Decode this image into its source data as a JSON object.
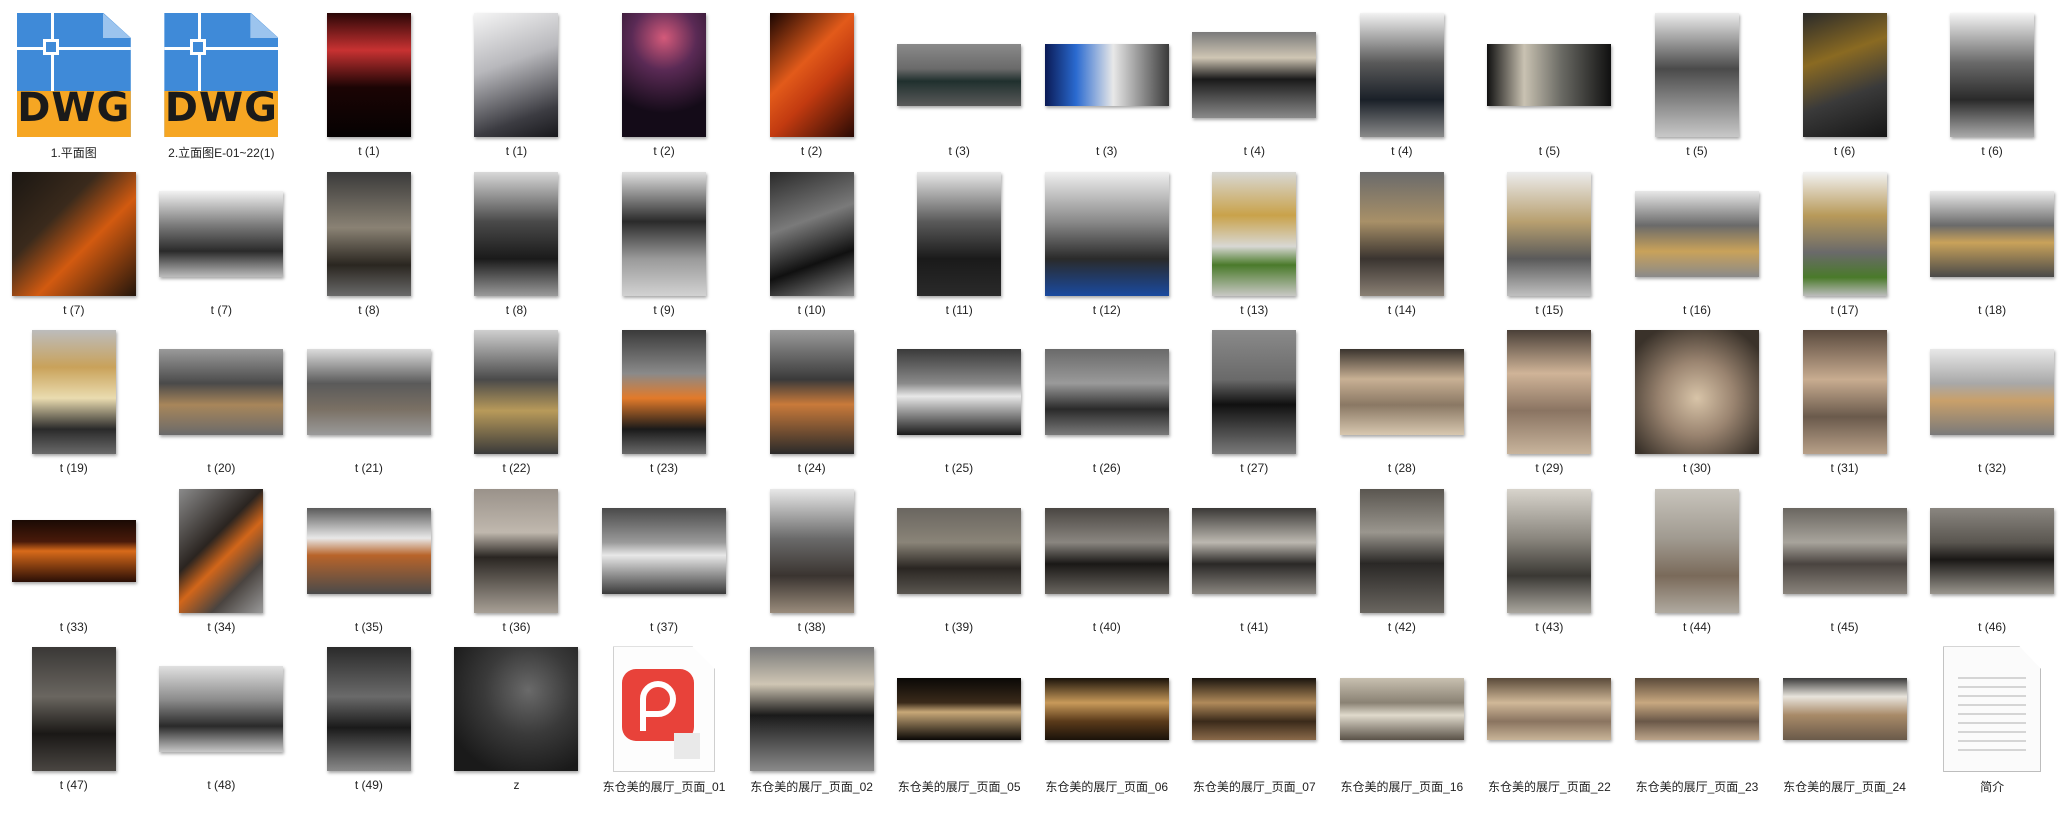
{
  "view": "large-icons",
  "files": [
    {
      "label": "1.平面图",
      "type": "dwg",
      "icon": "dwg-file-icon"
    },
    {
      "label": "2.立面图E-01~22(1)",
      "type": "dwg",
      "icon": "dwg-file-icon"
    },
    {
      "label": "t (1)",
      "type": "image",
      "shape": "portrait",
      "bg": "linear-gradient(180deg,#2a0606 0%,#c83232 30%,#1b0404 60%,#050202 100%)"
    },
    {
      "label": "t (1)",
      "type": "image",
      "shape": "portrait",
      "bg": "linear-gradient(160deg,#f5f5f5 0%,#b8b8bc 40%,#3c3c42 80%,#18181c 100%)"
    },
    {
      "label": "t (2)",
      "type": "image",
      "shape": "portrait",
      "bg": "radial-gradient(circle at 50% 20%,#d45a7a 0%,#5a2a55 30%,#140b18 70%)"
    },
    {
      "label": "t (2)",
      "type": "image",
      "shape": "portrait",
      "bg": "linear-gradient(135deg,#1a0602 0%,#e25a1a 40%,#c23a10 60%,#2a0a04 100%)"
    },
    {
      "label": "t (3)",
      "type": "image",
      "shape": "wide",
      "bg": "linear-gradient(180deg,#8a8a8a 0%,#6a6a6a 40%,#20302e 60%,#5a5a5a 100%)"
    },
    {
      "label": "t (3)",
      "type": "image",
      "shape": "wide",
      "bg": "linear-gradient(90deg,#0a1a55 0%,#2a6ad0 25%,#e8e8e8 55%,#3a3a3a 100%)"
    },
    {
      "label": "t (4)",
      "type": "image",
      "shape": "landscape",
      "bg": "linear-gradient(180deg,#7a7a7a 0%,#cfc6b4 30%,#1a1a1a 55%,#8a8a8a 100%)"
    },
    {
      "label": "t (4)",
      "type": "image",
      "shape": "portrait",
      "bg": "linear-gradient(180deg,#f2f2f2 0%,#5a5a5a 40%,#1a2028 70%,#8a8a8a 100%)"
    },
    {
      "label": "t (5)",
      "type": "image",
      "shape": "wide",
      "bg": "linear-gradient(90deg,#101010 0%,#c9c2b2 30%,#6a6a64 60%,#101010 100%)"
    },
    {
      "label": "t (5)",
      "type": "image",
      "shape": "portrait",
      "bg": "linear-gradient(180deg,#ededed 0%,#4a4a4a 45%,#c8c8c8 100%)"
    },
    {
      "label": "t (6)",
      "type": "image",
      "shape": "portrait",
      "bg": "linear-gradient(160deg,#2a2a2a 0%,#8a6a22 35%,#3a3a3a 65%,#161616 100%)"
    },
    {
      "label": "t (6)",
      "type": "image",
      "shape": "portrait",
      "bg": "linear-gradient(180deg,#f5f5f5 0%,#6a6a6a 40%,#2a2a2a 70%,#aaaaaa 100%)"
    },
    {
      "label": "t (7)",
      "type": "image",
      "shape": "square",
      "bg": "linear-gradient(135deg,#1a1612 0%,#3a2a1c 35%,#d25a10 60%,#24160c 100%)"
    },
    {
      "label": "t (7)",
      "type": "image",
      "shape": "landscape",
      "bg": "linear-gradient(180deg,#f2f2f2 0%,#7a7a7a 40%,#2a2a2a 70%,#bcbcbc 100%)"
    },
    {
      "label": "t (8)",
      "type": "image",
      "shape": "portrait",
      "bg": "linear-gradient(180deg,#3a3a3a 0%,#8a8274 45%,#2a2620 75%,#6a6a6a 100%)"
    },
    {
      "label": "t (8)",
      "type": "image",
      "shape": "portrait",
      "bg": "linear-gradient(180deg,#d8d8d8 0%,#4a4a4a 40%,#1a1a1a 70%,#9a9a9a 100%)"
    },
    {
      "label": "t (9)",
      "type": "image",
      "shape": "portrait",
      "bg": "linear-gradient(180deg,#e0e0e0 0%,#2a2a2a 40%,#9a9a9a 70%,#d2d2d2 100%)"
    },
    {
      "label": "t (10)",
      "type": "image",
      "shape": "portrait",
      "bg": "linear-gradient(160deg,#2a2a2a 0%,#7a7a7a 40%,#101010 70%,#8a8a8a 100%)"
    },
    {
      "label": "t (11)",
      "type": "image",
      "shape": "portrait",
      "bg": "linear-gradient(180deg,#e8e8e8 0%,#5a5a5a 40%,#1a1a1a 70%,#2a2a2a 100%)"
    },
    {
      "label": "t (12)",
      "type": "image",
      "shape": "square",
      "bg": "linear-gradient(180deg,#f0f0f0 0%,#8a8a8a 40%,#2a2a2a 70%,#1a4aa0 100%)"
    },
    {
      "label": "t (13)",
      "type": "image",
      "shape": "portrait",
      "bg": "linear-gradient(180deg,#d8d8d4 0%,#c9a24a 35%,#d8d8d4 60%,#4a7a2a 75%,#c8c8c4 100%)"
    },
    {
      "label": "t (14)",
      "type": "image",
      "shape": "portrait",
      "bg": "linear-gradient(180deg,#6a6a6a 0%,#a89068 40%,#3a3430 70%,#8a8074 100%)"
    },
    {
      "label": "t (15)",
      "type": "image",
      "shape": "portrait",
      "bg": "linear-gradient(180deg,#ececec 0%,#b8a070 40%,#5a5a5a 70%,#c0c0c0 100%)"
    },
    {
      "label": "t (16)",
      "type": "image",
      "shape": "landscape",
      "bg": "linear-gradient(180deg,#e8e8e8 0%,#6a6a6a 40%,#c9a25a 70%,#8a8a8a 100%)"
    },
    {
      "label": "t (17)",
      "type": "image",
      "shape": "portrait",
      "bg": "linear-gradient(180deg,#f2f2f2 0%,#b89a5a 35%,#6a6a6a 65%,#4a7a2a 85%,#bcbcbc 100%)"
    },
    {
      "label": "t (18)",
      "type": "image",
      "shape": "landscape",
      "bg": "linear-gradient(180deg,#ececec 0%,#6a6a6a 40%,#c9a25a 60%,#4a4a4a 100%)"
    },
    {
      "label": "t (19)",
      "type": "image",
      "shape": "portrait",
      "bg": "linear-gradient(180deg,#bcbcbc 0%,#c9a25a 30%,#eadcb0 55%,#2a2a2a 80%,#6a6a6a 100%)"
    },
    {
      "label": "t (20)",
      "type": "image",
      "shape": "landscape",
      "bg": "linear-gradient(180deg,#9a9a9a 0%,#4a4a4a 40%,#a8865a 65%,#6a6a6a 100%)"
    },
    {
      "label": "t (21)",
      "type": "image",
      "shape": "landscape",
      "bg": "linear-gradient(180deg,#dcdcdc 0%,#5a5a5a 40%,#7a7064 70%,#9a9a9a 100%)"
    },
    {
      "label": "t (22)",
      "type": "image",
      "shape": "portrait",
      "bg": "linear-gradient(180deg,#cfcfcf 0%,#4a4a4a 40%,#b89a5a 65%,#3a3a3a 100%)"
    },
    {
      "label": "t (23)",
      "type": "image",
      "shape": "portrait",
      "bg": "linear-gradient(180deg,#3a3a3a 0%,#8a8a8a 35%,#e27a2a 55%,#1a1a1a 80%,#6a6a6a 100%)"
    },
    {
      "label": "t (24)",
      "type": "image",
      "shape": "portrait",
      "bg": "linear-gradient(180deg,#9a9a9a 0%,#3a3a3a 40%,#c97a3a 60%,#2a2a2a 100%)"
    },
    {
      "label": "t (25)",
      "type": "image",
      "shape": "landscape",
      "bg": "linear-gradient(180deg,#3a3a3a 0%,#8a8a8a 40%,#e8e8e8 55%,#1a1a1a 100%)"
    },
    {
      "label": "t (26)",
      "type": "image",
      "shape": "landscape",
      "bg": "linear-gradient(180deg,#6a6a6a 0%,#9a9a9a 40%,#2a2a2a 70%,#7a7a7a 100%)"
    },
    {
      "label": "t (27)",
      "type": "image",
      "shape": "portrait",
      "bg": "linear-gradient(180deg,#8a8a8a 0%,#6a6a6a 40%,#101010 60%,#7a7a7a 100%)"
    },
    {
      "label": "t (28)",
      "type": "image",
      "shape": "landscape",
      "bg": "linear-gradient(180deg,#3a342e 0%,#c8b094 35%,#8a7864 65%,#d8c8b0 100%)"
    },
    {
      "label": "t (29)",
      "type": "image",
      "shape": "portrait",
      "bg": "linear-gradient(180deg,#4a4038 0%,#d0b498 35%,#8a7462 65%,#c8b49c 100%)"
    },
    {
      "label": "t (30)",
      "type": "image",
      "shape": "square",
      "bg": "radial-gradient(circle at 50% 55%,#d8c4a8 0%,#9a8470 40%,#3a322a 85%)"
    },
    {
      "label": "t (31)",
      "type": "image",
      "shape": "portrait",
      "bg": "linear-gradient(180deg,#5a4a3e 0%,#c8ac90 40%,#6a5a4c 70%,#b8a088 100%)"
    },
    {
      "label": "t (32)",
      "type": "image",
      "shape": "landscape",
      "bg": "linear-gradient(180deg,#e8e8e8 0%,#a8a8a8 40%,#c9a06a 60%,#7a7a7a 100%)"
    },
    {
      "label": "t (33)",
      "type": "image",
      "shape": "wide",
      "bg": "linear-gradient(180deg,#1a0a04 0%,#4a1a0a 35%,#d86a1a 50%,#2a0e06 100%)"
    },
    {
      "label": "t (34)",
      "type": "image",
      "shape": "portrait",
      "bg": "linear-gradient(135deg,#8a8a8a 0%,#2a2420 40%,#d2661a 55%,#4a4440 75%,#9a9a9a 100%)"
    },
    {
      "label": "t (35)",
      "type": "image",
      "shape": "landscape",
      "bg": "linear-gradient(180deg,#5a5a5a 0%,#e8e8e8 35%,#b8642a 55%,#4a4a4a 100%)"
    },
    {
      "label": "t (36)",
      "type": "image",
      "shape": "portrait",
      "bg": "linear-gradient(180deg,#9a928a 0%,#c0b8ae 35%,#2a2622 55%,#a8a096 100%)"
    },
    {
      "label": "t (37)",
      "type": "image",
      "shape": "landscape",
      "bg": "linear-gradient(180deg,#4a4a4a 0%,#9a9a9a 40%,#e8e8e8 55%,#3a3a3a 100%)"
    },
    {
      "label": "t (38)",
      "type": "image",
      "shape": "portrait",
      "bg": "linear-gradient(180deg,#e8e8e8 0%,#6a6a6a 40%,#3a3430 70%,#9a8c7c 100%)"
    },
    {
      "label": "t (39)",
      "type": "image",
      "shape": "landscape",
      "bg": "linear-gradient(180deg,#6a6660 0%,#8a8478 40%,#2a2622 70%,#5a5650 100%)"
    },
    {
      "label": "t (40)",
      "type": "image",
      "shape": "landscape",
      "bg": "linear-gradient(180deg,#4a4642 0%,#8a8680 40%,#1a1816 65%,#6a6660 100%)"
    },
    {
      "label": "t (41)",
      "type": "image",
      "shape": "landscape",
      "bg": "linear-gradient(180deg,#3a3836 0%,#bcb8b0 40%,#2a2826 65%,#8a8680 100%)"
    },
    {
      "label": "t (42)",
      "type": "image",
      "shape": "portrait",
      "bg": "linear-gradient(180deg,#5a5650 0%,#9a968e 35%,#2a2826 60%,#6a6660 100%)"
    },
    {
      "label": "t (43)",
      "type": "image",
      "shape": "portrait",
      "bg": "linear-gradient(180deg,#d8d4cc 0%,#8a867e 40%,#3a3834 70%,#aaa69e 100%)"
    },
    {
      "label": "t (44)",
      "type": "image",
      "shape": "portrait",
      "bg": "linear-gradient(180deg,#c8c4bc 0%,#a09a90 40%,#7a6a5a 70%,#b0aaa0 100%)"
    },
    {
      "label": "t (45)",
      "type": "image",
      "shape": "landscape",
      "bg": "linear-gradient(180deg,#6a6660 0%,#a8a49c 40%,#4a4440 65%,#8a847c 100%)"
    },
    {
      "label": "t (46)",
      "type": "image",
      "shape": "landscape",
      "bg": "linear-gradient(180deg,#8a8680 0%,#5a5650 40%,#1a1816 60%,#9a968e 100%)"
    },
    {
      "label": "t (47)",
      "type": "image",
      "shape": "portrait",
      "bg": "linear-gradient(180deg,#3a3836 0%,#6a6660 40%,#1a1816 70%,#4a4642 100%)"
    },
    {
      "label": "t (48)",
      "type": "image",
      "shape": "landscape",
      "bg": "linear-gradient(180deg,#e0e0e0 0%,#8a8a8a 40%,#2a2a2a 70%,#c8c8c8 100%)"
    },
    {
      "label": "t (49)",
      "type": "image",
      "shape": "portrait",
      "bg": "linear-gradient(180deg,#2a2a2a 0%,#6a6a6a 40%,#1a1a1a 65%,#8a8a8a 100%)"
    },
    {
      "label": "z",
      "type": "image",
      "shape": "square",
      "bg": "radial-gradient(circle at 60% 35%,#6a6a6a 0%,#3a3a3a 40%,#1a1a1a 80%)"
    },
    {
      "label": "东仓美的展厅_页面_01",
      "type": "pdf",
      "icon": "pdf-file-icon"
    },
    {
      "label": "东仓美的展厅_页面_02",
      "type": "image",
      "shape": "square",
      "bg": "linear-gradient(180deg,#7a7a7a 0%,#cfc6b4 30%,#1a1a1a 55%,#8a8a8a 100%)"
    },
    {
      "label": "东仓美的展厅_页面_05",
      "type": "image",
      "shape": "wide",
      "bg": "linear-gradient(180deg,#0a0806 0%,#3a2a1a 40%,#c8a878 55%,#0a0806 100%)"
    },
    {
      "label": "东仓美的展厅_页面_06",
      "type": "image",
      "shape": "wide",
      "bg": "linear-gradient(180deg,#1a120a 0%,#c89a5a 40%,#5a3a1a 70%,#1a120a 100%)"
    },
    {
      "label": "东仓美的展厅_页面_07",
      "type": "image",
      "shape": "wide",
      "bg": "linear-gradient(180deg,#1a140e 0%,#b08a5a 40%,#3a2a1a 70%,#8a6a4a 100%)"
    },
    {
      "label": "东仓美的展厅_页面_16",
      "type": "image",
      "shape": "wide",
      "bg": "linear-gradient(180deg,#c8c0b0 0%,#8a8274 40%,#e0dacc 60%,#5a5248 100%)"
    },
    {
      "label": "东仓美的展厅_页面_22",
      "type": "image",
      "shape": "wide",
      "bg": "linear-gradient(180deg,#5a4a3a 0%,#d0b898 40%,#8a7460 70%,#c8b498 100%)"
    },
    {
      "label": "东仓美的展厅_页面_23",
      "type": "image",
      "shape": "wide",
      "bg": "linear-gradient(180deg,#5a4a3a 0%,#c8a880 40%,#6a5848 70%,#bca48a 100%)"
    },
    {
      "label": "东仓美的展厅_页面_24",
      "type": "image",
      "shape": "wide",
      "bg": "linear-gradient(180deg,#3a3a3a 0%,#e8e4dc 30%,#a88a68 60%,#6a5a4a 100%)"
    },
    {
      "label": "简介",
      "type": "blank",
      "icon": "text-file-icon"
    }
  ]
}
